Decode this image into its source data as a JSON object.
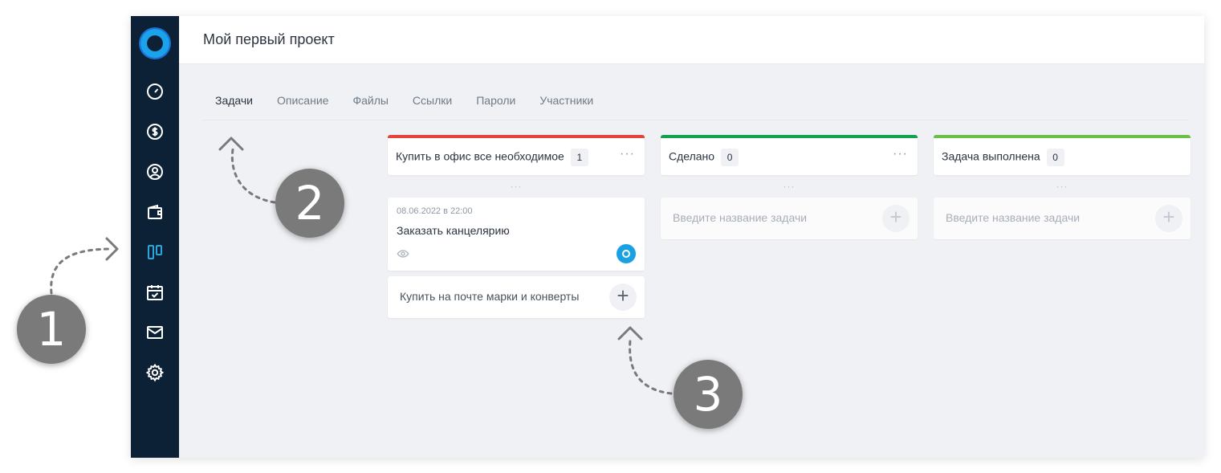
{
  "app": {
    "title": "Мой первый проект"
  },
  "sidebar": {
    "items": [
      {
        "icon": "dashboard-icon"
      },
      {
        "icon": "dollar-icon"
      },
      {
        "icon": "user-icon"
      },
      {
        "icon": "wallet-icon"
      },
      {
        "icon": "kanban-icon"
      },
      {
        "icon": "calendar-check-icon"
      },
      {
        "icon": "mail-icon"
      },
      {
        "icon": "gear-icon"
      }
    ]
  },
  "tabs": [
    {
      "label": "Задачи",
      "active": true
    },
    {
      "label": "Описание"
    },
    {
      "label": "Файлы"
    },
    {
      "label": "Ссылки"
    },
    {
      "label": "Пароли"
    },
    {
      "label": "Участники"
    }
  ],
  "columns": [
    {
      "title": "Купить в офис все необходимое",
      "count": "1",
      "color": "#e5433b",
      "more": "···",
      "drag": "···",
      "task": {
        "date": "08.06.2022 в 22:00",
        "name": "Заказать канцелярию"
      },
      "input": "Купить на почте марки и конверты",
      "add": "+"
    },
    {
      "title": "Сделано",
      "count": "0",
      "color": "#12a150",
      "more": "···",
      "drag": "···",
      "input": "Введите название задачи",
      "add": "+"
    },
    {
      "title": "Задача выполнена",
      "count": "0",
      "color": "#6cc04a",
      "drag": "···",
      "input": "Введите название задачи",
      "add": "+"
    }
  ],
  "annotations": [
    "1",
    "2",
    "3"
  ],
  "colors": {
    "sidebar": "#0d2136",
    "accent": "#27a6e0",
    "background": "#eff1f4"
  }
}
